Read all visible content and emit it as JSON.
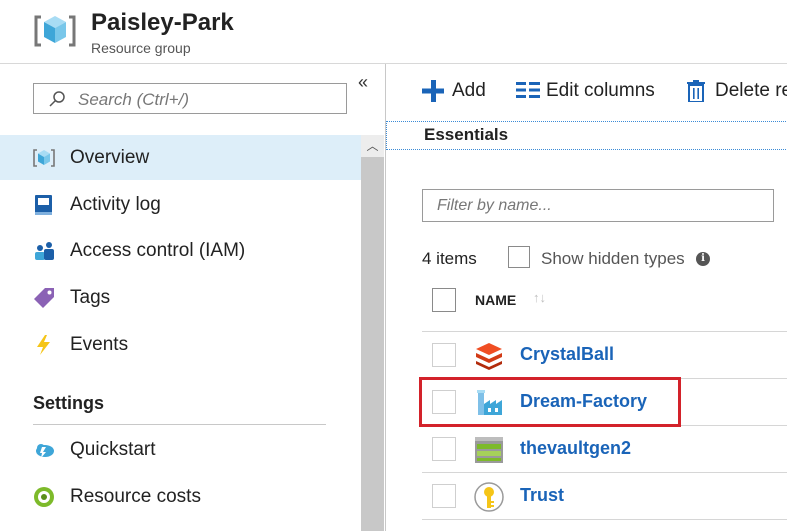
{
  "header": {
    "title": "Paisley-Park",
    "subtitle": "Resource group",
    "icon": "resource-group-cube-icon"
  },
  "sidebar": {
    "collapse_glyph": "«",
    "search_placeholder": "Search (Ctrl+/)",
    "items": [
      {
        "label": "Overview",
        "icon": "cube-icon",
        "active": true
      },
      {
        "label": "Activity log",
        "icon": "book-icon"
      },
      {
        "label": "Access control (IAM)",
        "icon": "people-icon"
      },
      {
        "label": "Tags",
        "icon": "tag-icon"
      },
      {
        "label": "Events",
        "icon": "lightning-icon"
      }
    ],
    "settings_title": "Settings",
    "settings_items": [
      {
        "label": "Quickstart",
        "icon": "cloud-icon"
      },
      {
        "label": "Resource costs",
        "icon": "cost-icon"
      }
    ]
  },
  "toolbar": {
    "add": "Add",
    "edit_columns": "Edit columns",
    "delete": "Delete re"
  },
  "essentials": "Essentials",
  "filter_placeholder": "Filter by name...",
  "list": {
    "count": "4 items",
    "show_hidden": "Show hidden types",
    "column_name": "NAME",
    "sort_glyph": "↑↓",
    "rows": [
      {
        "name": "CrystalBall",
        "icon": "layers-icon"
      },
      {
        "name": "Dream-Factory",
        "icon": "factory-icon",
        "highlighted": true
      },
      {
        "name": "thevaultgen2",
        "icon": "storage-icon"
      },
      {
        "name": "Trust",
        "icon": "key-vault-icon"
      }
    ]
  },
  "colors": {
    "accent": "#1a64b8",
    "active_bg": "#ddeef9",
    "highlight": "#d3222a"
  }
}
